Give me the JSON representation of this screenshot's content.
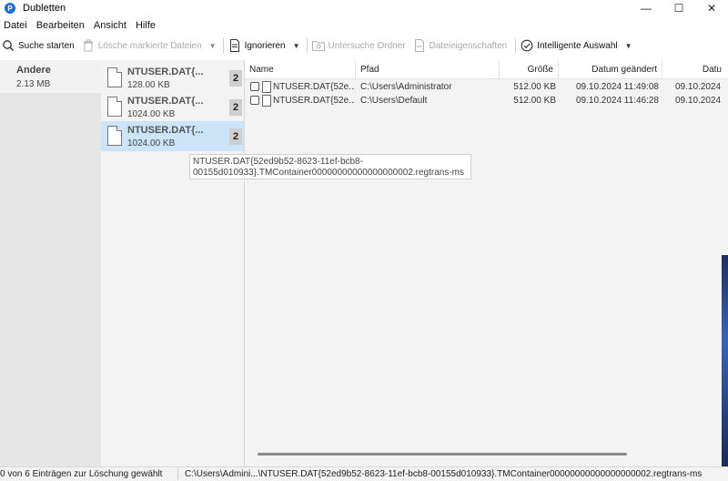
{
  "window": {
    "title": "Dubletten",
    "app_icon_letter": "P",
    "minimize_glyph": "—",
    "maximize_glyph": "☐",
    "close_glyph": "✕"
  },
  "menu": [
    "Datei",
    "Bearbeiten",
    "Ansicht",
    "Hilfe"
  ],
  "toolbar": {
    "search_label": "Suche starten",
    "delete_label": "Lösche markierte Dateien",
    "ignore_label": "Ignorieren",
    "examine_folder_label": "Untersuche Ordner",
    "file_props_label": "Dateieigenschaften",
    "smart_select_label": "Intelligente Auswahl",
    "dropdown_glyph": "▼"
  },
  "categories": [
    {
      "title": "Andere",
      "size": "2.13 MB"
    }
  ],
  "file_groups": [
    {
      "name": "NTUSER.DAT{...",
      "size": "128.00 KB",
      "count": "2",
      "selected": false
    },
    {
      "name": "NTUSER.DAT{...",
      "size": "1024.00 KB",
      "count": "2",
      "selected": false
    },
    {
      "name": "NTUSER.DAT{...",
      "size": "1024.00 KB",
      "count": "2",
      "selected": true
    }
  ],
  "table": {
    "columns": [
      "Name",
      "Pfad",
      "Größe",
      "Datum geändert",
      "Datu"
    ],
    "rows": [
      {
        "name": "NTUSER.DAT{52e...",
        "path": "C:\\Users\\Administrator",
        "size": "512.00 KB",
        "modified": "09.10.2024 11:49:08",
        "extra": "09.10.2024"
      },
      {
        "name": "NTUSER.DAT{52e...",
        "path": "C:\\Users\\Default",
        "size": "512.00 KB",
        "modified": "09.10.2024 11:46:28",
        "extra": "09.10.2024"
      }
    ]
  },
  "tooltip": {
    "line1": "NTUSER.DAT{52ed9b52-8623-11ef-bcb8-",
    "line2": "00155d010933}.TMContainer00000000000000000002.regtrans-ms"
  },
  "status": {
    "left": "0 von 6 Einträgen zur Löschung gewählt",
    "right": "C:\\Users\\Admini...\\NTUSER.DAT{52ed9b52-8623-11ef-bcb8-00155d010933}.TMContainer00000000000000000002.regtrans-ms"
  },
  "colors": {
    "selection": "#cce4f7",
    "app_icon": "#1e6fd9"
  }
}
